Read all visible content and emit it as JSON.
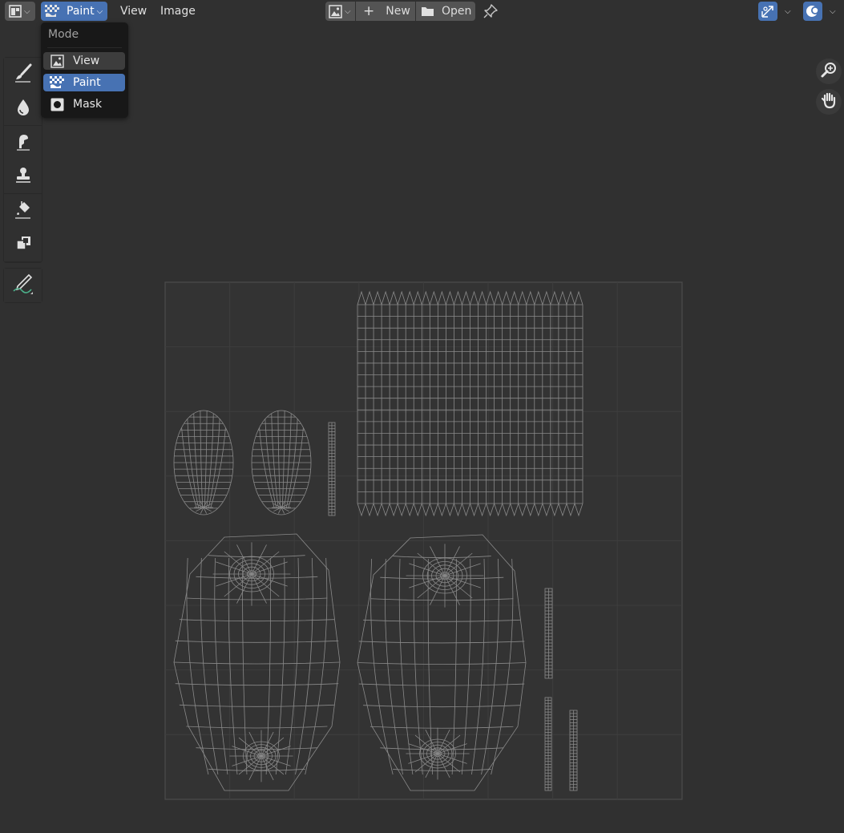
{
  "header": {
    "editor_type_icon": "image-editor-icon",
    "mode_button": {
      "label": "Paint",
      "icon": "checker-paint-icon"
    },
    "menus": [
      "View",
      "Image"
    ],
    "image_browse_icon": "image-browse-icon",
    "new_button": {
      "label": "New",
      "icon": "plus-icon"
    },
    "open_button": {
      "label": "Open",
      "icon": "folder-icon"
    },
    "pin_icon": "pin-icon",
    "uv_sync_icon": "uv-sync-icon",
    "overlay_icon": "overlay-icon",
    "accent_color": "#4772b3"
  },
  "mode_menu": {
    "title": "Mode",
    "items": [
      {
        "label": "View",
        "icon": "image-view-icon",
        "state": "hover"
      },
      {
        "label": "Paint",
        "icon": "checker-paint-icon",
        "state": "selected"
      },
      {
        "label": "Mask",
        "icon": "mask-icon",
        "state": "normal"
      }
    ]
  },
  "toolbar": {
    "tools": [
      "draw-brush-icon",
      "soften-drop-icon",
      "smear-finger-icon",
      "clone-stamp-icon",
      "fill-bucket-icon",
      "mask-tool-icon",
      "annotate-pencil-icon"
    ],
    "active": "draw-brush-icon"
  },
  "navigation": [
    "zoom-icon",
    "pan-hand-icon"
  ]
}
